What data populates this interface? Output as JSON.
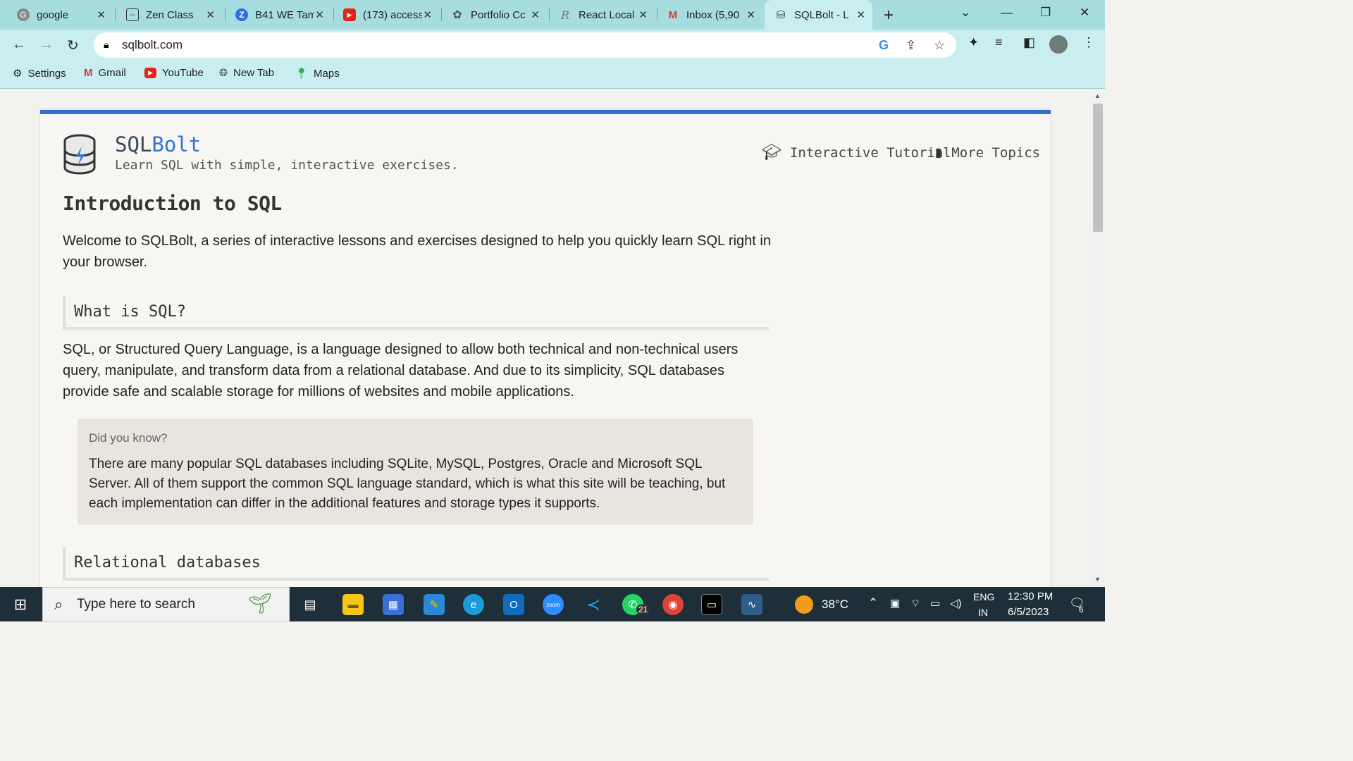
{
  "browser": {
    "tabs": [
      {
        "title": "google",
        "icon": "google-icon"
      },
      {
        "title": "Zen Class",
        "icon": "zen-class-icon"
      },
      {
        "title": "B41 WE Tam",
        "icon": "z-icon"
      },
      {
        "title": "(173) access",
        "icon": "youtube-icon"
      },
      {
        "title": "Portfolio Cc",
        "icon": "openai-icon"
      },
      {
        "title": "React Local",
        "icon": "react-icon"
      },
      {
        "title": "Inbox (5,90",
        "icon": "gmail-icon"
      },
      {
        "title": "SQLBolt - L",
        "icon": "sqlbolt-icon"
      }
    ],
    "url": "sqlbolt.com",
    "bookmarks": [
      {
        "label": "Settings",
        "icon": "gear-icon"
      },
      {
        "label": "Gmail",
        "icon": "gmail-icon"
      },
      {
        "label": "YouTube",
        "icon": "youtube-icon"
      },
      {
        "label": "New Tab",
        "icon": "globe-icon"
      },
      {
        "label": "Maps",
        "icon": "maps-icon"
      }
    ]
  },
  "page": {
    "brand_prefix": "SQL",
    "brand_suffix": "Bolt",
    "tagline": "Learn SQL with simple, interactive exercises.",
    "nav": {
      "tutorial": "Interactive Tutorial",
      "topics": "More Topics"
    },
    "title": "Introduction to SQL",
    "intro": "Welcome to SQLBolt, a series of interactive lessons and exercises designed to help you quickly learn SQL right in your browser.",
    "section1_title": "What is SQL?",
    "section1_body": "SQL, or Structured Query Language, is a language designed to allow both technical and non-technical users query, manipulate, and transform data from a relational database. And due to its simplicity, SQL databases provide safe and scalable storage for millions of websites and mobile applications.",
    "callout_title": "Did you know?",
    "callout_body": "There are many popular SQL databases including SQLite, MySQL, Postgres, Oracle and Microsoft SQL Server. All of them support the common SQL language standard, which is what this site will be teaching, but each implementation can differ in the additional features and storage types it supports.",
    "section2_title": "Relational databases"
  },
  "taskbar": {
    "search_placeholder": "Type here to search",
    "weather": "38°C",
    "lang_line1": "ENG",
    "lang_line2": "IN",
    "time": "12:30 PM",
    "date": "6/5/2023",
    "whatsapp_badge": "21",
    "notification_count": "6"
  },
  "colors": {
    "accent": "#2f6fd6",
    "chrome_frame": "#a8dde0",
    "chrome_toolbar": "#c8eef0",
    "taskbar": "#1f2f3a"
  }
}
